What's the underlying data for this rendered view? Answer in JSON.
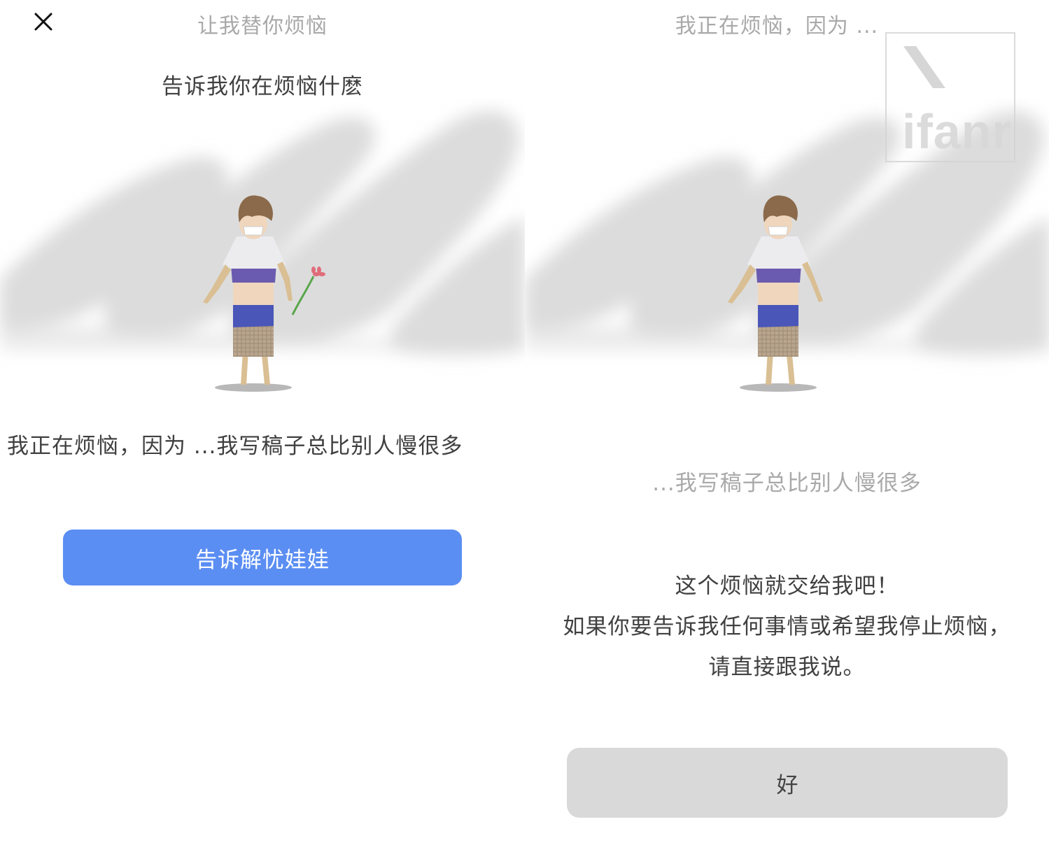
{
  "left": {
    "title": "让我替你烦恼",
    "close_icon": "close-icon",
    "prompt": "告诉我你在烦恼什麽",
    "worry_line": "我正在烦恼，因为 ...我写稿子总比别人慢很多",
    "button_label": "告诉解忧娃娃",
    "button_color": "#5b8ef3"
  },
  "right": {
    "title": "我正在烦恼，因为 ...",
    "echo": "...我写稿子总比别人慢很多",
    "message_lines": [
      "这个烦恼就交给我吧！",
      "如果你要告诉我任何事情或希望我停止烦恼，",
      "请直接跟我说。"
    ],
    "ok_label": "好",
    "ok_color": "#d9d9d9",
    "watermark": "ifanr"
  }
}
